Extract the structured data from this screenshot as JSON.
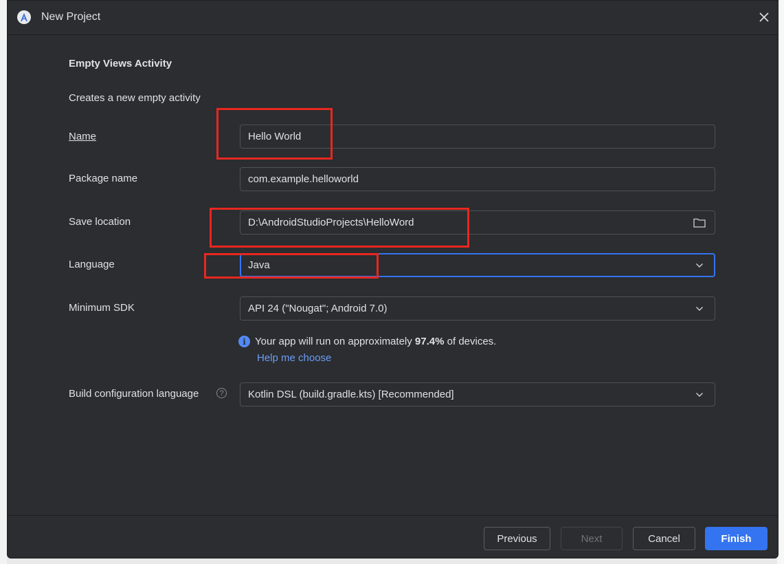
{
  "dialog": {
    "title": "New Project",
    "heading": "Empty Views Activity",
    "description": "Creates a new empty activity"
  },
  "form": {
    "name": {
      "label": "Name",
      "value": "Hello World"
    },
    "package": {
      "label": "Package name",
      "value": "com.example.helloworld"
    },
    "save_location": {
      "label": "Save location",
      "value": "D:\\AndroidStudioProjects\\HelloWord",
      "icon": "folder-icon"
    },
    "language": {
      "label": "Language",
      "value": "Java"
    },
    "min_sdk": {
      "label": "Minimum SDK",
      "value": "API 24 (\"Nougat\"; Android 7.0)"
    },
    "build_config": {
      "label": "Build configuration language",
      "value": "Kotlin DSL (build.gradle.kts) [Recommended]"
    }
  },
  "info": {
    "text_before": "Your app will run on approximately ",
    "percent": "97.4%",
    "text_after": " of devices.",
    "help_link": "Help me choose"
  },
  "footer": {
    "previous": "Previous",
    "next": "Next",
    "cancel": "Cancel",
    "finish": "Finish"
  },
  "colors": {
    "dialog_bg": "#2b2d30",
    "accent": "#3574f0",
    "link": "#6c9cf7",
    "annotation": "#e8271f"
  }
}
